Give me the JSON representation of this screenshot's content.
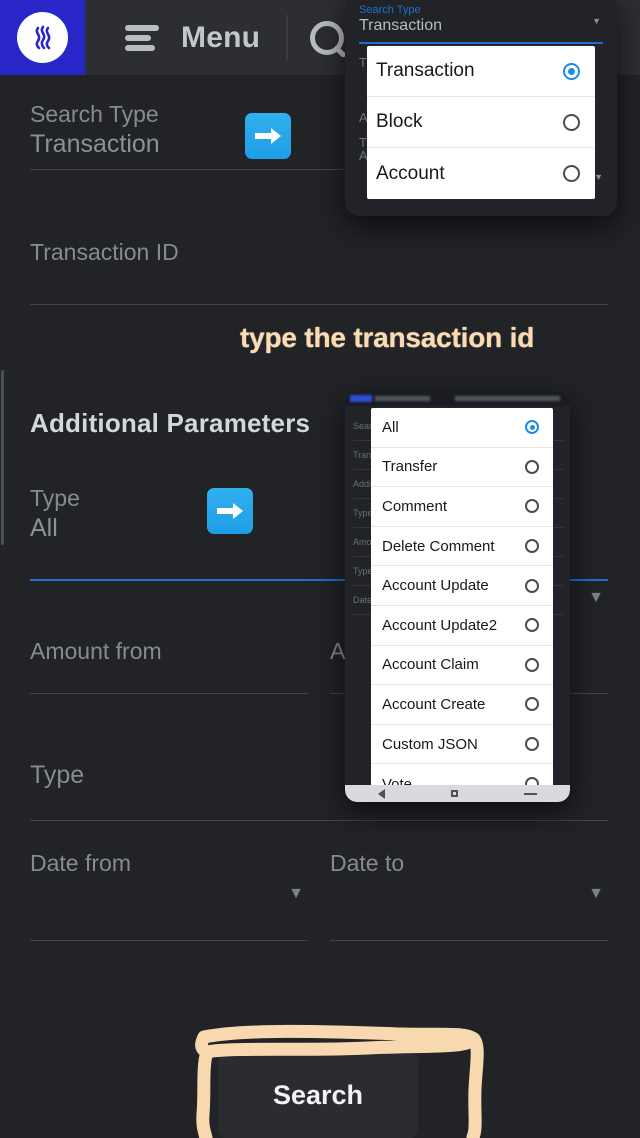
{
  "header": {
    "logo_name": "steem-logo",
    "menu_icon": "hamburger-menu-icon",
    "menu_label": "Menu",
    "search_icon": "search-icon"
  },
  "form": {
    "search_type": {
      "label": "Search Type",
      "value": "Transaction"
    },
    "transaction_id": {
      "label": "Transaction ID",
      "value": ""
    },
    "section_title": "Additional Parameters",
    "type": {
      "label": "Type",
      "value": "All"
    },
    "amount_from": {
      "label": "Amount from",
      "value": ""
    },
    "amount_to": {
      "label": "Amount to",
      "value": ""
    },
    "type_2": {
      "label": "Type",
      "value": ""
    },
    "date_from": {
      "label": "Date from",
      "value": ""
    },
    "date_to": {
      "label": "Date to",
      "value": ""
    },
    "search_button": "Search"
  },
  "annotations": {
    "transaction_id_note": "type the transaction id",
    "search_highlight_color": "#fbdcb2",
    "arrow_icon": "right-arrow-emoji"
  },
  "overlay_search_type": {
    "field_label": "Search Type",
    "field_value": "Transaction",
    "ghost_labels": [
      "Transaction ID",
      "Additional Parameters",
      "Type",
      "All"
    ],
    "options": [
      {
        "label": "Transaction",
        "selected": true
      },
      {
        "label": "Block",
        "selected": false
      },
      {
        "label": "Account",
        "selected": false
      }
    ]
  },
  "overlay_type": {
    "ghost_labels": [
      "Search Type",
      "Transaction",
      "Transaction ID",
      "Additional Parameters",
      "Type",
      "All",
      "Amount from",
      "Type",
      "Date from"
    ],
    "options": [
      {
        "label": "All",
        "selected": true
      },
      {
        "label": "Transfer",
        "selected": false
      },
      {
        "label": "Comment",
        "selected": false
      },
      {
        "label": "Delete Comment",
        "selected": false
      },
      {
        "label": "Account Update",
        "selected": false
      },
      {
        "label": "Account Update2",
        "selected": false
      },
      {
        "label": "Account Claim",
        "selected": false
      },
      {
        "label": "Account Create",
        "selected": false
      },
      {
        "label": "Custom JSON",
        "selected": false
      },
      {
        "label": "Vote",
        "selected": false
      }
    ],
    "nav_bar": [
      "back-button",
      "home-button",
      "recents-button"
    ]
  },
  "colors": {
    "background": "#212327",
    "header": "#2c2e32",
    "brand_blue": "#2826c9",
    "accent_blue": "#1d6fd0",
    "radio_blue": "#1b8ce8",
    "annotation": "#fbdcb2"
  }
}
